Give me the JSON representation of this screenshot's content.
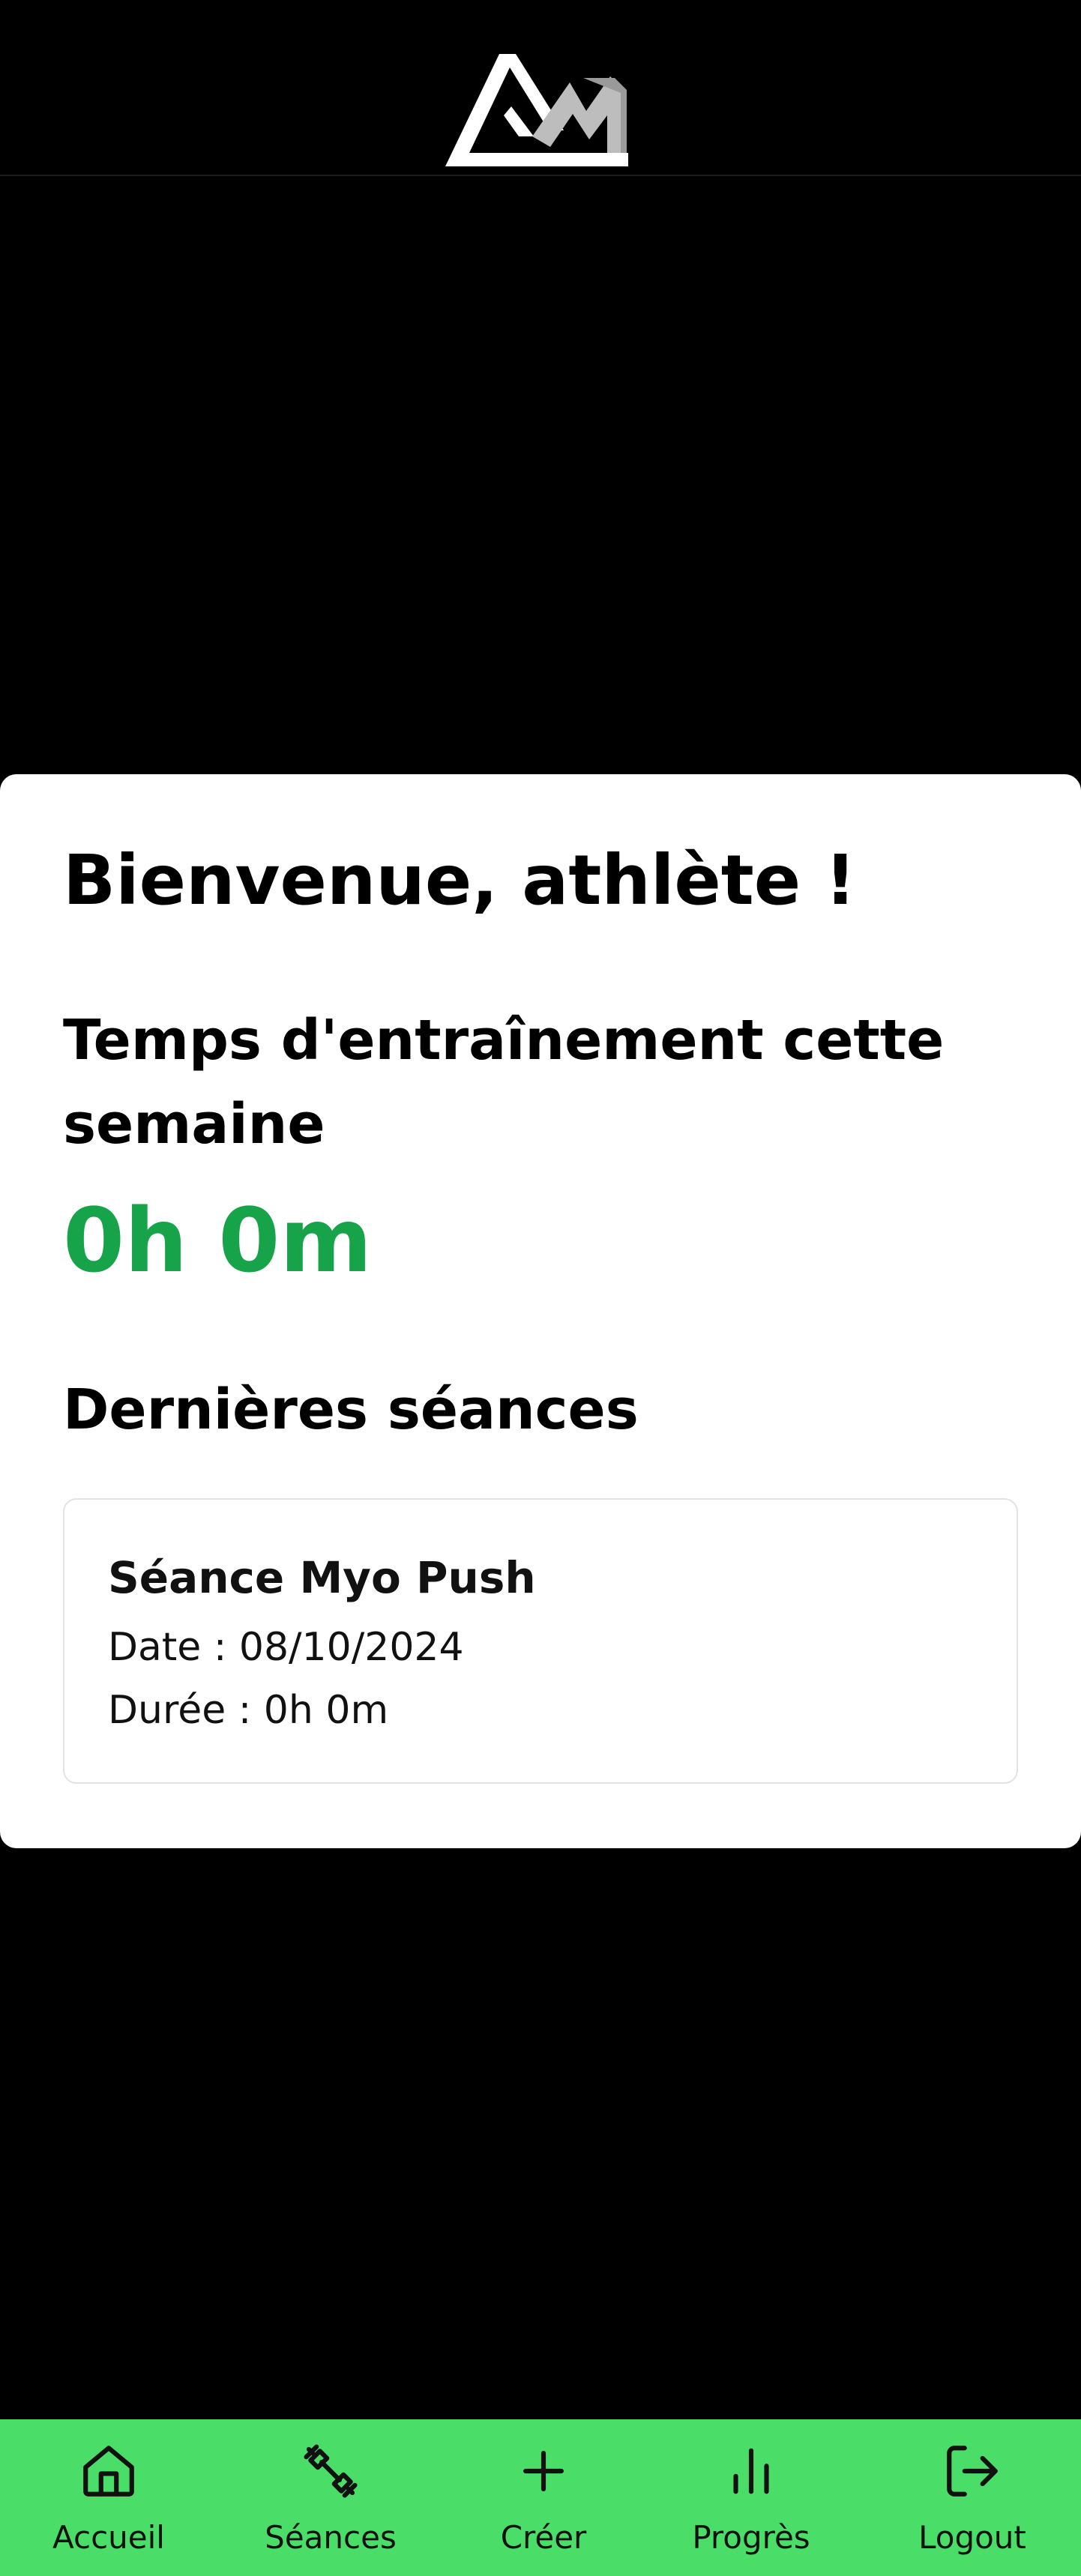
{
  "header": {
    "logo_icon": "dm-mountain-logo"
  },
  "home": {
    "welcome": "Bienvenue, athlète !",
    "week_label": "Temps d'entraînement cette semaine",
    "week_time": "0h 0m",
    "recent_title": "Dernières séances"
  },
  "sessions": [
    {
      "name": "Séance Myo Push",
      "date": "Date : 08/10/2024",
      "duration": "Durée : 0h 0m"
    }
  ],
  "nav": {
    "items": [
      {
        "label": "Accueil",
        "icon": "home-icon"
      },
      {
        "label": "Séances",
        "icon": "dumbbell-icon"
      },
      {
        "label": "Créer",
        "icon": "plus-icon"
      },
      {
        "label": "Progrès",
        "icon": "bar-chart-icon"
      },
      {
        "label": "Logout",
        "icon": "logout-icon"
      }
    ]
  },
  "colors": {
    "background": "#000000",
    "accent_green": "#16a34a",
    "nav_green": "#4ade68",
    "card": "#ffffff"
  }
}
